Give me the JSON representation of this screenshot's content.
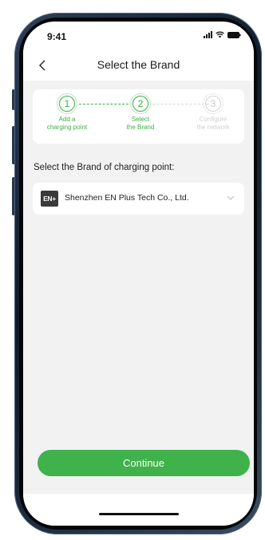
{
  "status_bar": {
    "time": "9:41",
    "icons": [
      "signal-icon",
      "wifi-icon",
      "battery-icon"
    ]
  },
  "nav": {
    "title": "Select the Brand",
    "back_icon": "chevron-left-icon"
  },
  "stepper": {
    "steps": [
      {
        "number": "1",
        "label": "Add a\ncharging point",
        "state": "active"
      },
      {
        "number": "2",
        "label": "Select\nthe Brand",
        "state": "active"
      },
      {
        "number": "3",
        "label": "Configure\nthe network",
        "state": "inactive"
      }
    ]
  },
  "brand_section": {
    "label": "Select the Brand of charging point:",
    "selected_brand": {
      "logo_text": "EN+",
      "name": "Shenzhen EN Plus Tech Co., Ltd."
    }
  },
  "actions": {
    "continue_label": "Continue"
  },
  "colors": {
    "accent": "#3fb24b",
    "background": "#f2f2f2"
  }
}
